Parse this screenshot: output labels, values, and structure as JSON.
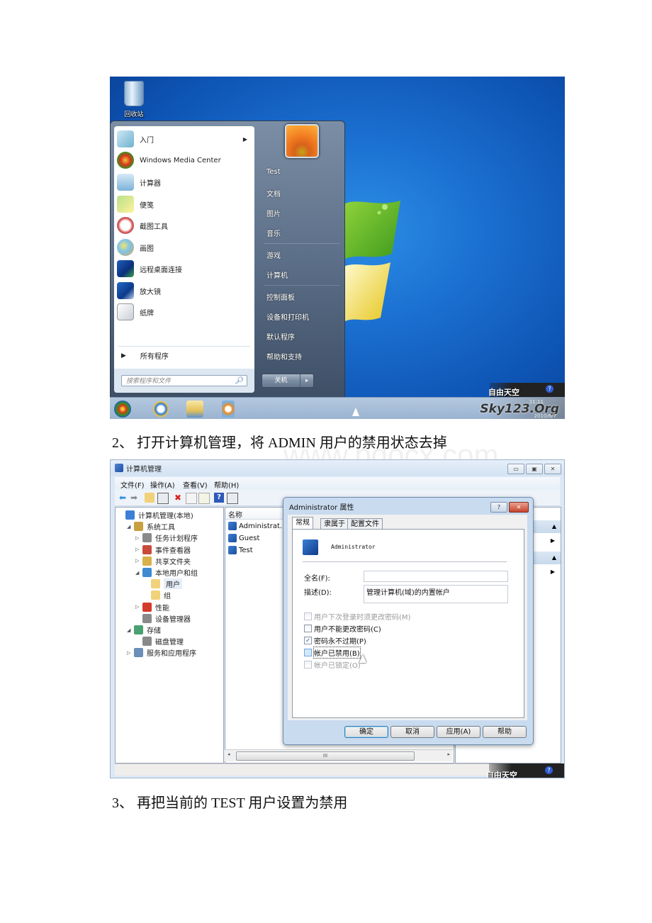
{
  "screenshot1": {
    "desktop": {
      "recycle_bin_label": "回收站"
    },
    "start_menu": {
      "pinned": [
        {
          "label": "入门",
          "icon": "getting-started-icon",
          "has_submenu": true
        },
        {
          "label": "Windows Media Center",
          "icon": "media-center-icon"
        },
        {
          "label": "计算器",
          "icon": "calculator-icon"
        },
        {
          "label": "便笺",
          "icon": "sticky-notes-icon"
        },
        {
          "label": "截图工具",
          "icon": "snipping-tool-icon"
        },
        {
          "label": "画图",
          "icon": "paint-icon"
        },
        {
          "label": "远程桌面连接",
          "icon": "remote-desktop-icon"
        },
        {
          "label": "放大镜",
          "icon": "magnifier-icon"
        },
        {
          "label": "纸牌",
          "icon": "solitaire-icon"
        }
      ],
      "all_programs": "所有程序",
      "search_placeholder": "搜索程序和文件",
      "right_items": [
        "Test",
        "文档",
        "图片",
        "音乐",
        "游戏",
        "计算机",
        "控制面板",
        "设备和打印机",
        "默认程序",
        "帮助和支持"
      ],
      "shutdown_label": "关机"
    },
    "taskbar": {
      "icons": [
        "start-orb-icon",
        "internet-explorer-icon",
        "explorer-folder-icon",
        "media-player-icon"
      ],
      "watermark": "Sky123.Org",
      "watermark_top": "自由天空",
      "clock_time": "11:11",
      "clock_date": "2010/6/7"
    }
  },
  "caption2": "2、 打开计算机管理，将 ADMIN 用户的禁用状态去掉",
  "screenshot2": {
    "window_title": "计算机管理",
    "menu": [
      "文件(F)",
      "操作(A)",
      "查看(V)",
      "帮助(H)"
    ],
    "tree": [
      {
        "label": "计算机管理(本地)",
        "level": 0,
        "expander": ""
      },
      {
        "label": "系统工具",
        "level": 1,
        "expander": "◢"
      },
      {
        "label": "任务计划程序",
        "level": 2,
        "expander": "▷"
      },
      {
        "label": "事件查看器",
        "level": 2,
        "expander": "▷"
      },
      {
        "label": "共享文件夹",
        "level": 2,
        "expander": "▷"
      },
      {
        "label": "本地用户和组",
        "level": 2,
        "expander": "◢"
      },
      {
        "label": "用户",
        "level": 3,
        "expander": "",
        "selected": true
      },
      {
        "label": "组",
        "level": 3,
        "expander": ""
      },
      {
        "label": "性能",
        "level": 2,
        "expander": "▷"
      },
      {
        "label": "设备管理器",
        "level": 2,
        "expander": ""
      },
      {
        "label": "存储",
        "level": 1,
        "expander": "◢"
      },
      {
        "label": "磁盘管理",
        "level": 2,
        "expander": ""
      },
      {
        "label": "服务和应用程序",
        "level": 1,
        "expander": "▷"
      }
    ],
    "list_header": "名称",
    "users": [
      "Administrat...",
      "Guest",
      "Test"
    ],
    "scroll_grip": "III",
    "dialog": {
      "title": "Administrator 属性",
      "help_btn": "?",
      "close_btn": "✕",
      "tabs": [
        "常规",
        "隶属于",
        "配置文件"
      ],
      "active_tab": 0,
      "username": "Administrator",
      "fullname_label": "全名(F):",
      "fullname_value": "",
      "desc_label": "描述(D):",
      "desc_value": "管理计算机(域)的内置帐户",
      "checkboxes": [
        {
          "label": "用户下次登录时须更改密码(M)",
          "checked": false,
          "disabled": true
        },
        {
          "label": "用户不能更改密码(C)",
          "checked": false,
          "disabled": false
        },
        {
          "label": "密码永不过期(P)",
          "checked": true,
          "disabled": false
        },
        {
          "label": "帐户已禁用(B)",
          "checked": false,
          "disabled": false,
          "focused": true
        },
        {
          "label": "帐户已锁定(O)",
          "checked": false,
          "disabled": true
        }
      ],
      "buttons": [
        "确定",
        "取消",
        "应用(A)",
        "帮助"
      ]
    }
  },
  "caption3": "3、 再把当前的 TEST 用户设置为禁用",
  "background_watermark": "www.bdocx.com"
}
